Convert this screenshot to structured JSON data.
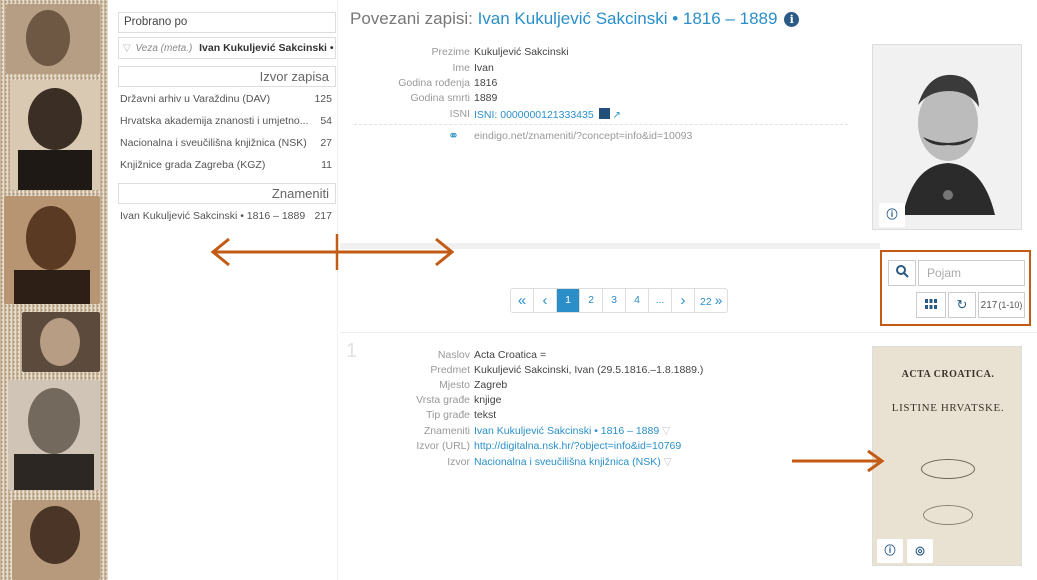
{
  "facets": {
    "filter_title": "Probrano po",
    "active_filter_prefix": "Veza (meta.)",
    "active_filter_value": "Ivan Kukuljević Sakcinski •",
    "sections": [
      {
        "title": "Izvor zapisa",
        "items": [
          {
            "label": "Državni arhiv u Varaždinu (DAV)",
            "count": "125"
          },
          {
            "label": "Hrvatska akademija znanosti i umjetno...",
            "count": "54"
          },
          {
            "label": "Nacionalna i sveučilišna knjižnica (NSK)",
            "count": "27"
          },
          {
            "label": "Knjižnice grada Zagreba (KGZ)",
            "count": "11"
          }
        ]
      },
      {
        "title": "Znameniti",
        "items": [
          {
            "label": "Ivan Kukuljević Sakcinski • 1816 – 1889",
            "count": "217"
          }
        ]
      }
    ]
  },
  "heading": {
    "prefix": "Povezani zapisi:",
    "link": "Ivan Kukuljević Sakcinski • 1816 – 1889",
    "info_icon": "i"
  },
  "person": {
    "fields": [
      {
        "label": "Prezime",
        "value": "Kukuljević Sakcinski"
      },
      {
        "label": "Ime",
        "value": "Ivan"
      },
      {
        "label": "Godina rođenja",
        "value": "1816"
      },
      {
        "label": "Godina smrti",
        "value": "1889"
      },
      {
        "label": "ISNI",
        "value": "ISNI: 0000000121333435"
      }
    ],
    "link_url": "eindigo.net/znameniti/?concept=info&id=10093"
  },
  "pagination": {
    "first": "«",
    "prev": "‹",
    "pages": [
      "1",
      "2",
      "3",
      "4",
      "..."
    ],
    "next": "›",
    "last": "22",
    "last_icon": "»"
  },
  "search": {
    "placeholder": "Pojam",
    "result_count": "217",
    "result_range": "(1-10)"
  },
  "record": {
    "index": "1",
    "fields": [
      {
        "label": "Naslov",
        "value": "Acta Croatica ="
      },
      {
        "label": "Predmet",
        "value": "Kukuljević Sakcinski, Ivan (29.5.1816.–1.8.1889.)"
      },
      {
        "label": "Mjesto",
        "value": "Zagreb"
      },
      {
        "label": "Vrsta građe",
        "value": "knjige"
      },
      {
        "label": "Tip građe",
        "value": "tekst"
      },
      {
        "label": "Znameniti",
        "value": "Ivan Kukuljević Sakcinski • 1816 – 1889"
      },
      {
        "label": "Izvor (URL)",
        "value": "http://digitalna.nsk.hr/?object=info&id=10769"
      },
      {
        "label": "Izvor",
        "value": "Nacionalna i sveučilišna knjižnica (NSK)"
      }
    ],
    "book_title_1": "ACTA CROATICA.",
    "book_title_2": "LISTINE HRVATSKE."
  },
  "colors": {
    "accent": "#2a8fc9",
    "annotation": "#c35a15"
  }
}
